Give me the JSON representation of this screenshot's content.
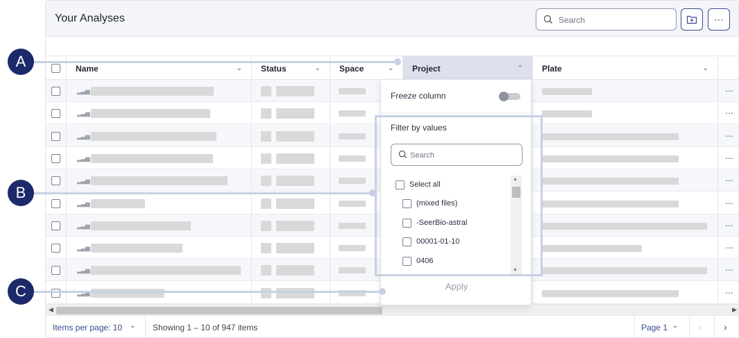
{
  "header": {
    "title": "Your Analyses",
    "search_placeholder": "Search",
    "more_label": "⋯"
  },
  "table": {
    "columns": [
      {
        "label": "Name"
      },
      {
        "label": "Status"
      },
      {
        "label": "Space"
      },
      {
        "label": "Project"
      },
      {
        "label": "Plate"
      }
    ],
    "row_menu_label": "⋯"
  },
  "dropdown": {
    "freeze_label": "Freeze column",
    "filter_label": "Filter by values",
    "search_placeholder": "Search",
    "options": [
      {
        "label": "Select all"
      },
      {
        "label": "(mixed files)"
      },
      {
        "label": "-SeerBio-astral"
      },
      {
        "label": "00001-01-10"
      },
      {
        "label": "0406"
      }
    ],
    "apply_label": "Apply"
  },
  "footer": {
    "items_per_page": "Items per page: 10",
    "showing": "Showing 1 – 10 of 947 items",
    "page": "Page 1"
  },
  "callouts": {
    "a": "A",
    "b": "B",
    "c": "C"
  }
}
